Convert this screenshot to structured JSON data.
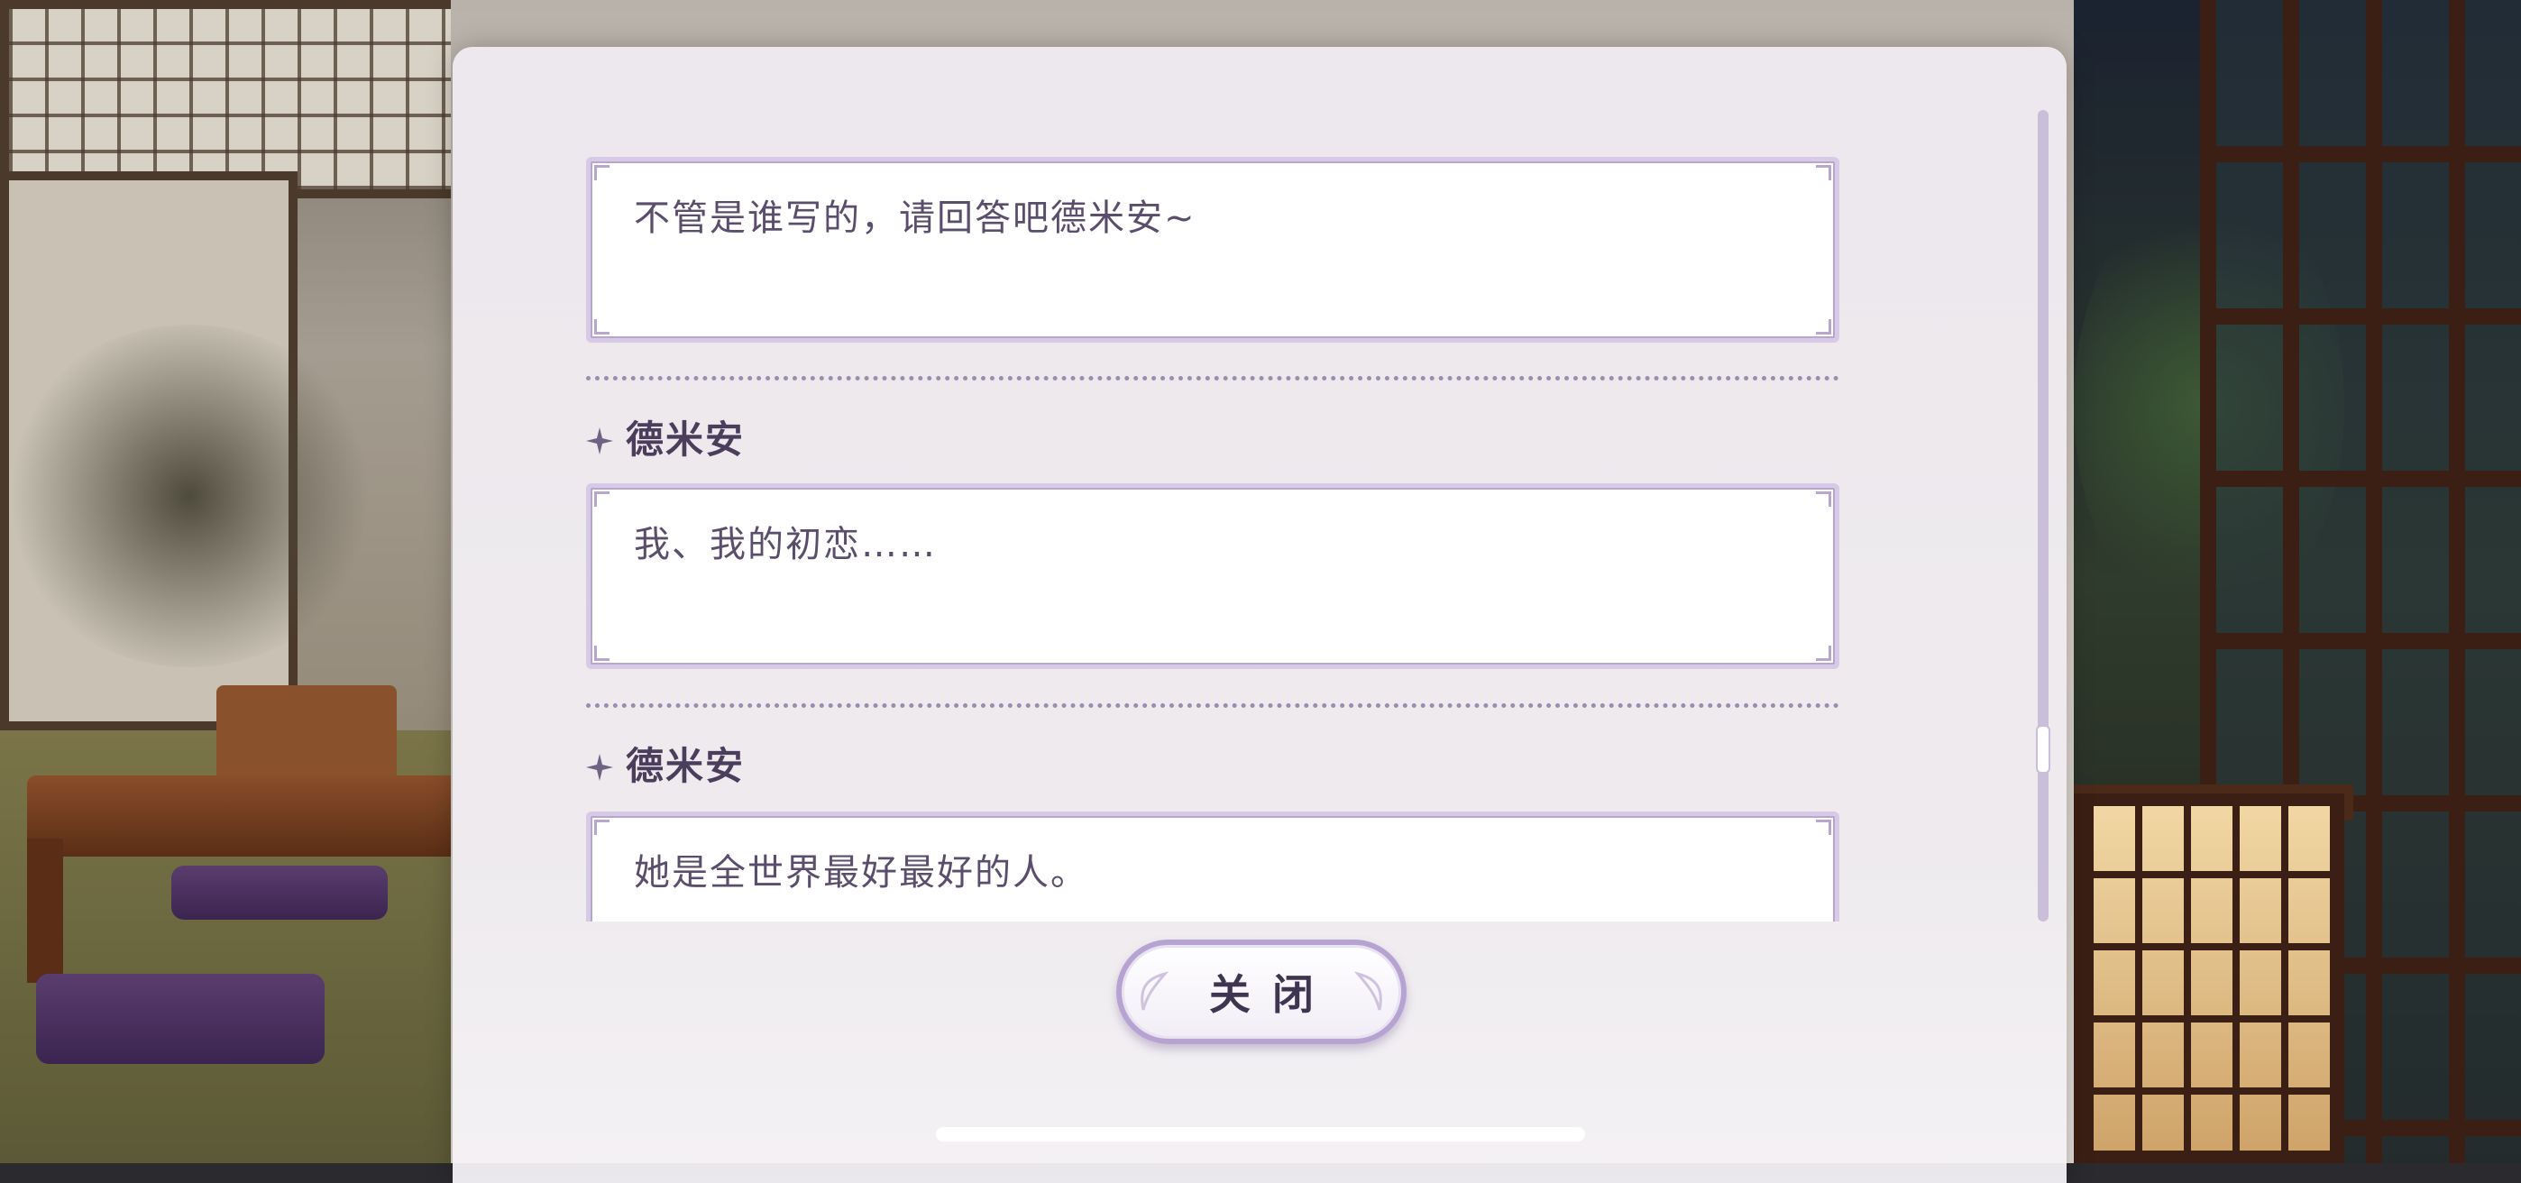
{
  "log": {
    "entries": [
      {
        "speaker": "",
        "text": "不管是谁写的，请回答吧德米安~"
      },
      {
        "speaker": "德米安",
        "text": "我、我的初恋……"
      },
      {
        "speaker": "德米安",
        "text": "她是全世界最好最好的人。"
      }
    ],
    "scroll_position": 0.7
  },
  "close_button": {
    "label": "关闭"
  },
  "colors": {
    "accent": "#b7a3d2",
    "text": "#5a4e6c",
    "speaker": "#4a3e5c"
  },
  "icons": {
    "speaker_marker": "four-point-star-icon",
    "close_ornament": "leaf-ornament-icon"
  }
}
